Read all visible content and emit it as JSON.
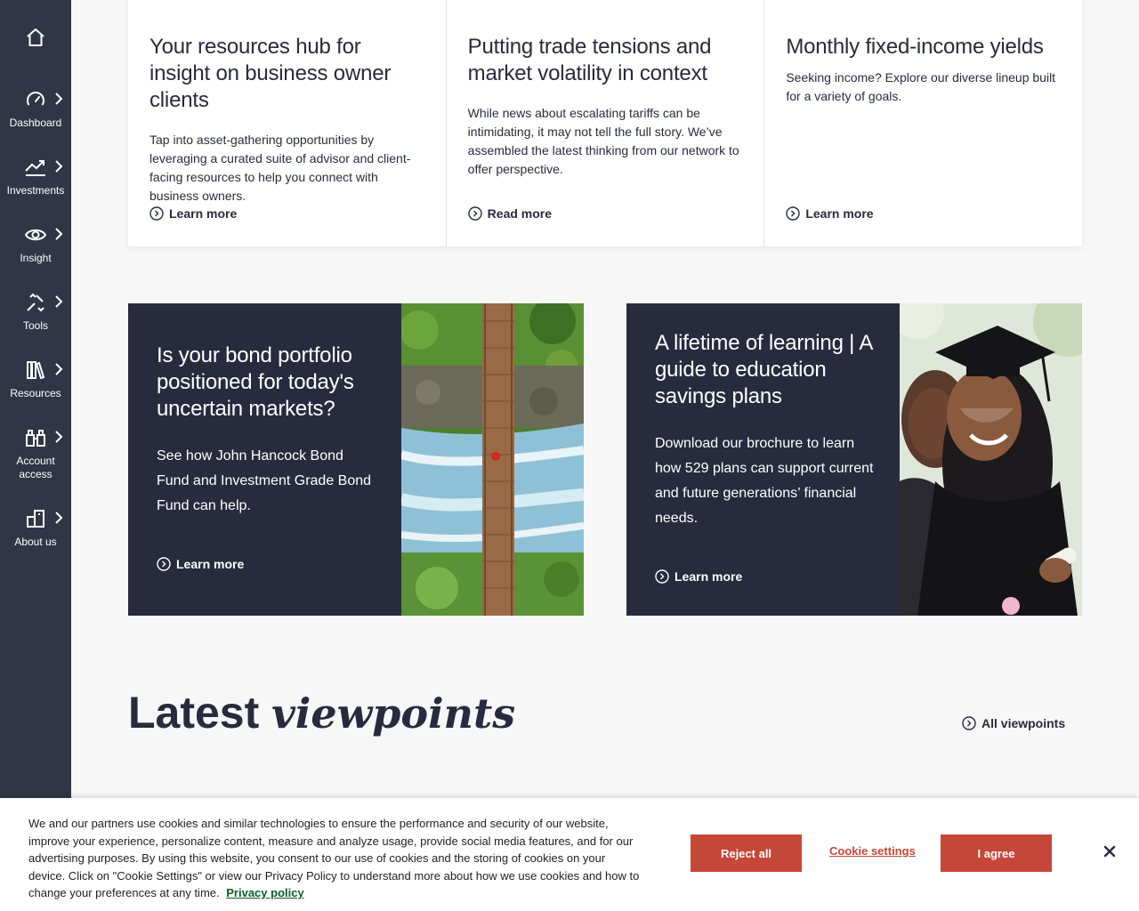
{
  "sidebar": {
    "home_icon": "home-icon",
    "items": [
      {
        "label": "Dashboard",
        "icon": "gauge-icon"
      },
      {
        "label": "Investments",
        "icon": "trend-icon"
      },
      {
        "label": "Insight",
        "icon": "eye-icon"
      },
      {
        "label": "Tools",
        "icon": "tools-icon"
      },
      {
        "label": "Resources",
        "icon": "books-icon"
      },
      {
        "label": "Account access",
        "icon": "binoculars-icon"
      },
      {
        "label": "About us",
        "icon": "building-icon"
      }
    ]
  },
  "top_cards": [
    {
      "title": "Your resources hub for insight on business owner clients",
      "body": "Tap into asset-gathering opportunities by leveraging a curated suite of advisor and client-facing resources to help you connect with business owners.",
      "link": "Learn more"
    },
    {
      "title": "Putting trade tensions and market volatility in context",
      "body": "While news about escalating tariffs can be intimidating, it may not tell the full story. We’ve assembled the latest thinking from our network to offer perspective.",
      "link": "Read more"
    },
    {
      "title": "Monthly fixed-income yields",
      "body": "Seeking income? Explore our diverse lineup built for a variety of goals.",
      "link": "Learn more"
    }
  ],
  "promos": [
    {
      "title": "Is your bond portfolio positioned for today's uncertain markets?",
      "body": "See how John Hancock Bond Fund and Investment Grade Bond Fund can help.",
      "link": "Learn more",
      "image": "aerial bridge over river"
    },
    {
      "title": "A lifetime of learning | A guide to education savings plans",
      "body": "Download our brochure to learn how 529 plans can support current and future generations’ financial needs.",
      "link": "Learn more",
      "image": "graduate with family"
    }
  ],
  "latest": {
    "title_plain": "Latest",
    "title_italic": "viewpoints",
    "all_link": "All viewpoints"
  },
  "cookie": {
    "message": "We and our partners use cookies and similar technologies to ensure the performance and security of our website, improve your experience, personalize content, measure and analyze usage, provide social media features, and for our advertising purposes. By using this website, you consent to our use of cookies and the storing of cookies on your device. Click on \"Cookie Settings\" or view our Privacy Policy to understand more about how we use cookies and how to change your preferences at any time.",
    "privacy_link": "Privacy policy",
    "reject": "Reject all",
    "settings": "Cookie settings",
    "agree": "I agree"
  },
  "colors": {
    "sidebar": "#303646",
    "navy": "#282b3e",
    "accent": "#c5473a",
    "privacy_link": "#0a5f2a"
  }
}
